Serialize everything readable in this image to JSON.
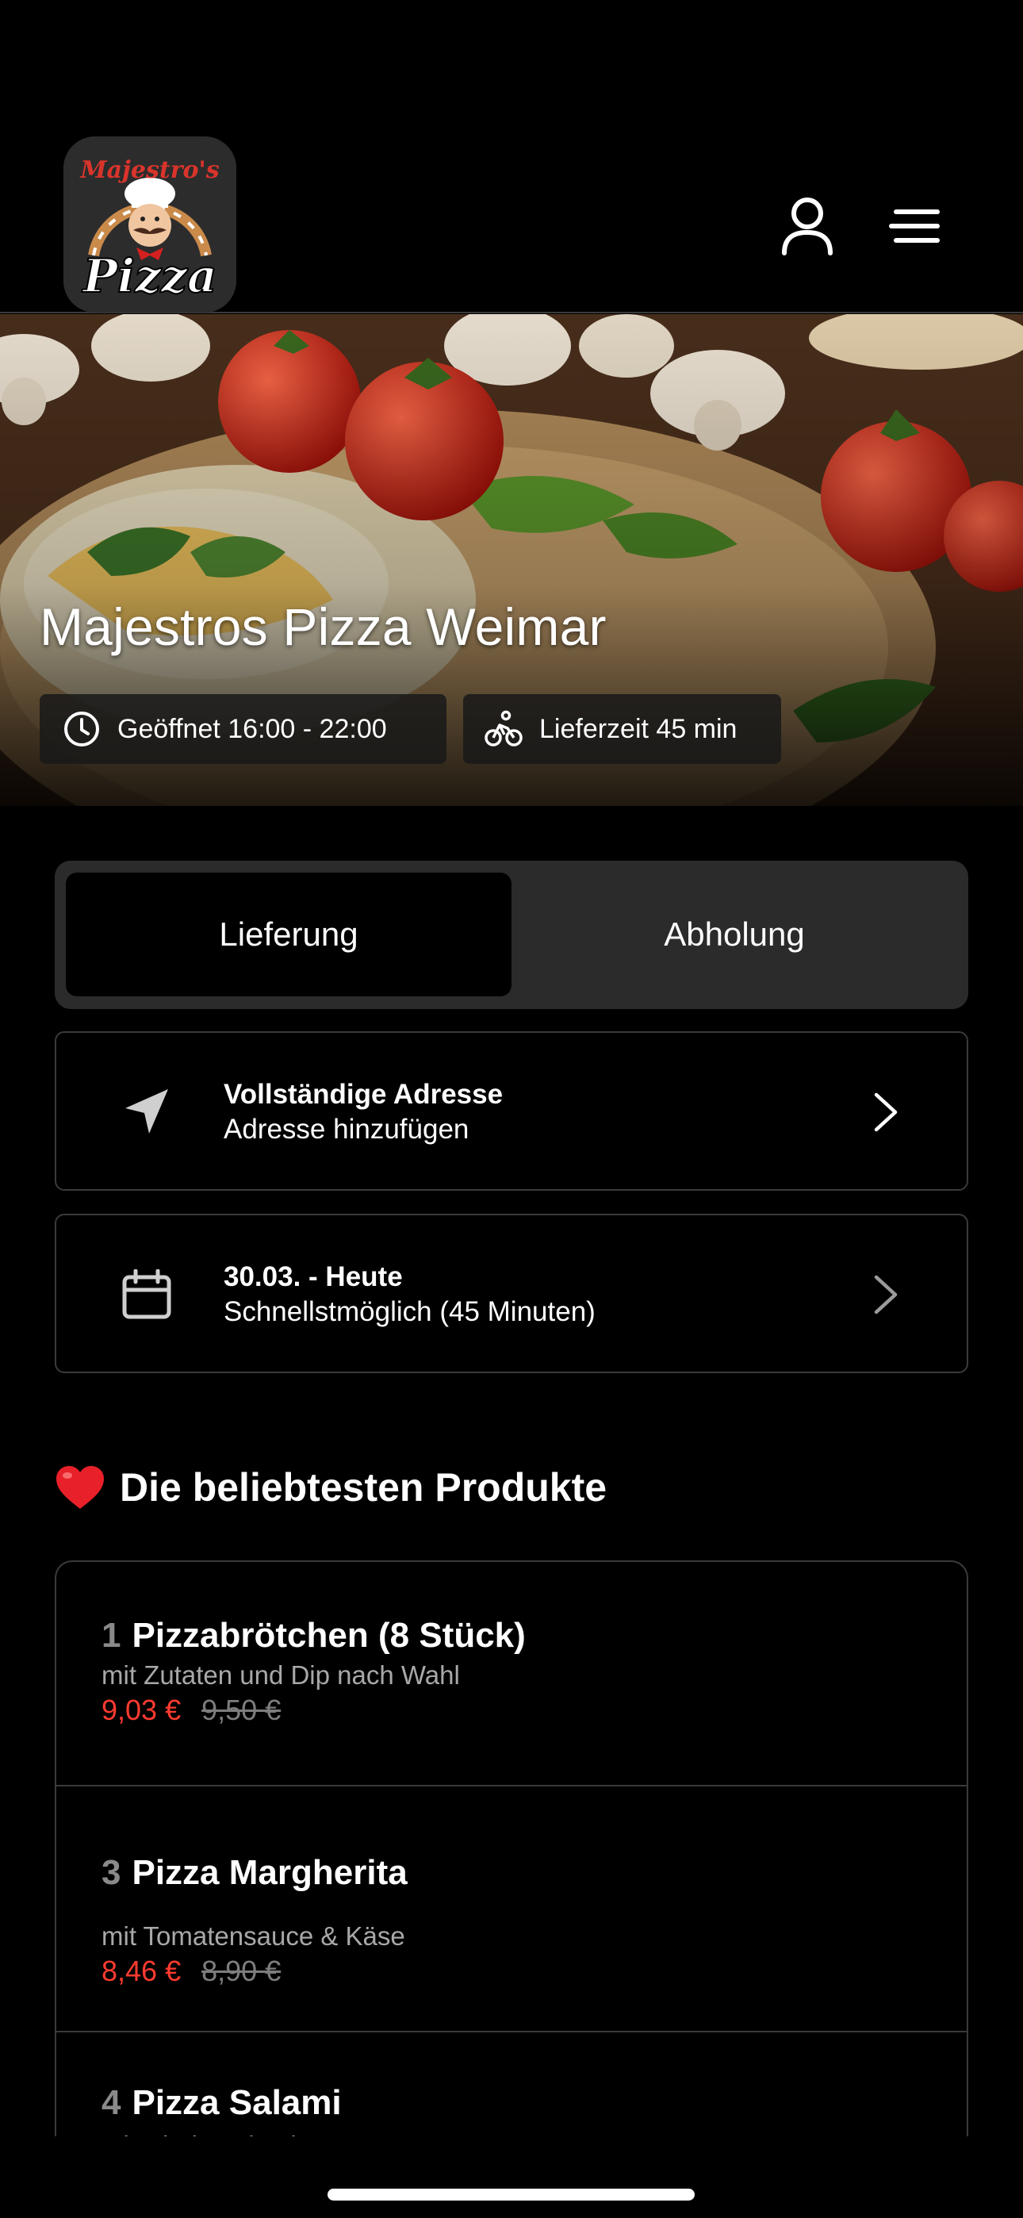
{
  "brand": {
    "logo_text_top": "Majestro's",
    "logo_text_bottom": "Pizza"
  },
  "header": {
    "account_icon": "user-icon",
    "menu_icon": "hamburger-menu-icon"
  },
  "hero": {
    "title": "Majestros Pizza Weimar",
    "hours_icon": "clock-icon",
    "hours": "Geöffnet 16:00 - 22:00",
    "delivery_icon": "bicycle-icon",
    "delivery_time": "Lieferzeit 45 min"
  },
  "order_mode": {
    "selected": "Lieferung",
    "options": [
      "Lieferung",
      "Abholung"
    ]
  },
  "address": {
    "icon": "location-arrow-icon",
    "title": "Vollständige Adresse",
    "subtitle": "Adresse hinzufügen"
  },
  "schedule": {
    "icon": "calendar-icon",
    "title": "30.03. - Heute",
    "subtitle": "Schnellstmöglich (45 Minuten)"
  },
  "popular": {
    "icon": "heart-icon",
    "title": "Die beliebtesten Produkte",
    "items": [
      {
        "number": "1",
        "name": "Pizzabrötchen (8 Stück)",
        "description": "mit Zutaten und Dip nach Wahl",
        "price": "9,03 €",
        "old_price": "9,50 €"
      },
      {
        "number": "3",
        "name": "Pizza Margherita",
        "description": "mit Tomatensauce & Käse",
        "price": "8,46 €",
        "old_price": "8,90 €"
      },
      {
        "number": "4",
        "name": "Pizza Salami",
        "description": "mit Rindersalami"
      }
    ]
  },
  "colors": {
    "background": "#000000",
    "surface": "#2b2b2b",
    "border": "#3a3a3a",
    "price_accent": "#ff3b30"
  }
}
